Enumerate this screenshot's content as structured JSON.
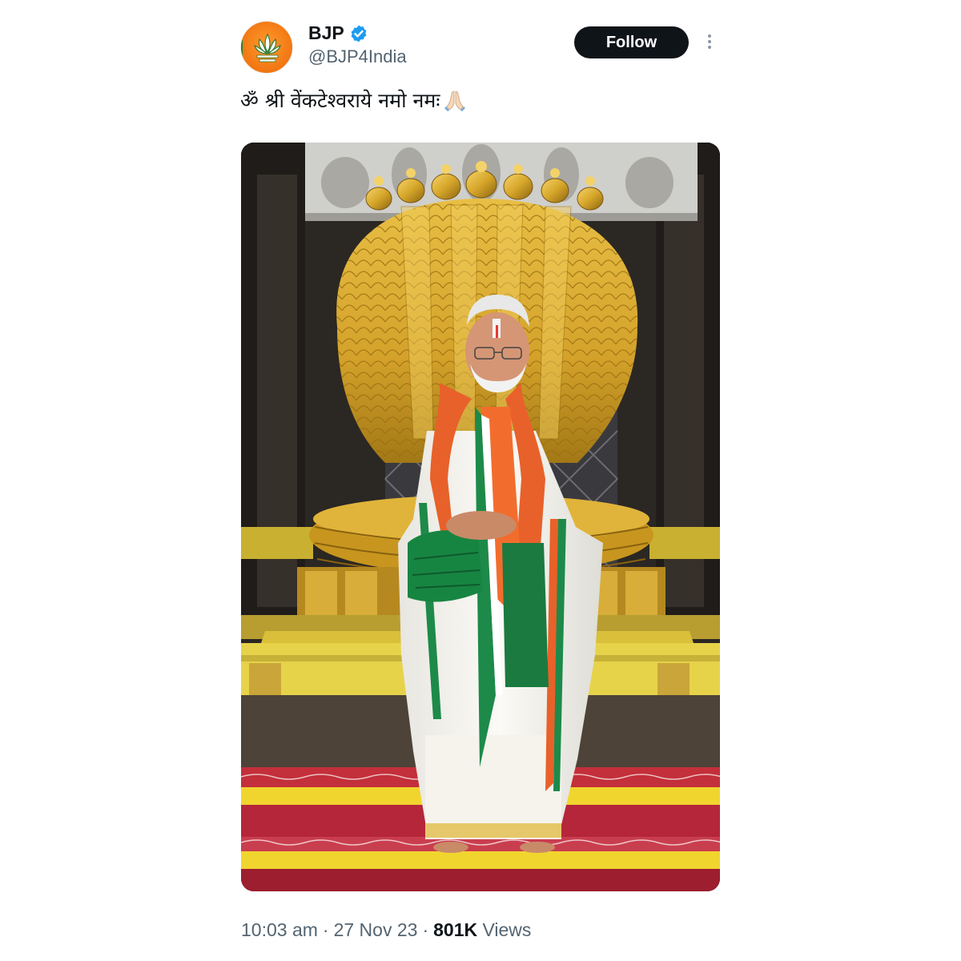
{
  "author": {
    "display_name": "BJP",
    "handle": "@BJP4India",
    "verified": true,
    "avatar_icon": "bjp-lotus-icon"
  },
  "follow_label": "Follow",
  "tweet": {
    "text": "ॐ श्री वेंकटेश्वराये नमो नमः",
    "emoji_icon": "folded-hands-icon"
  },
  "media": {
    "type": "photo"
  },
  "meta": {
    "time": "10:03 am",
    "separator1": "·",
    "date": "27 Nov 23",
    "separator2": "·",
    "views_count": "801K",
    "views_label": "Views"
  },
  "colors": {
    "follow_bg": "#0f1419",
    "verified": "#1d9bf0",
    "muted_text": "#536471",
    "avatar_orange": "#f47b16"
  }
}
